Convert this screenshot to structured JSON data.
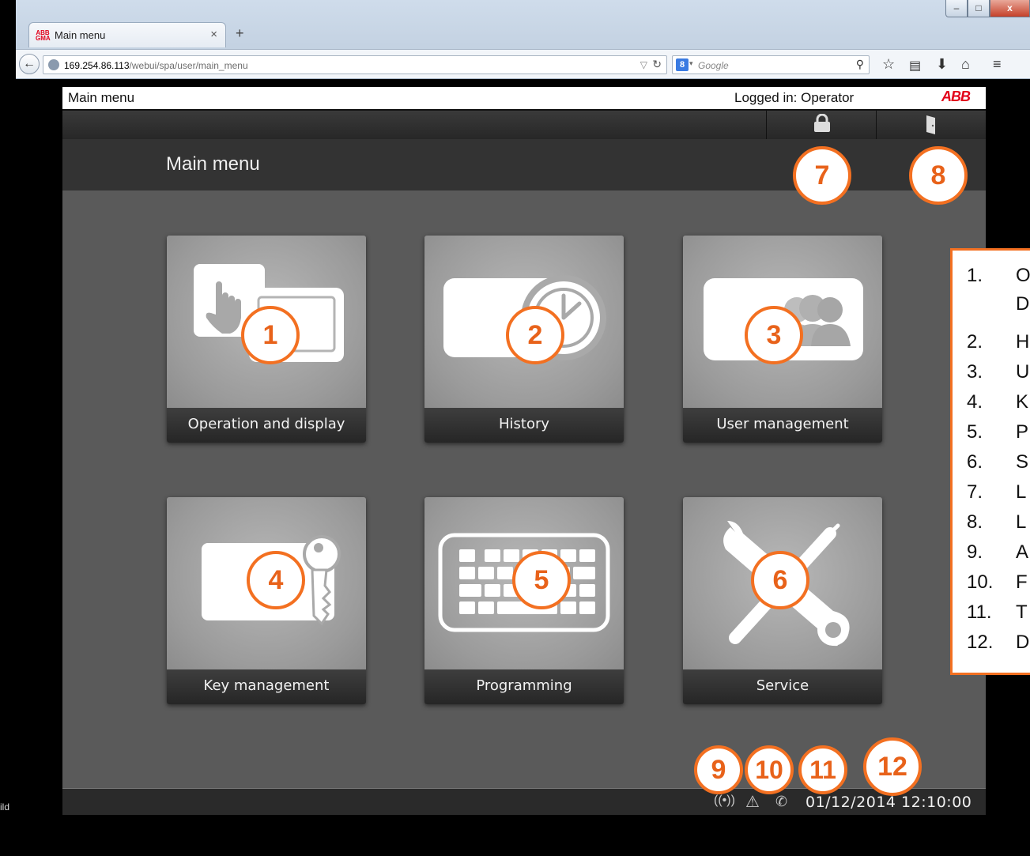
{
  "browser": {
    "tab_title": "Main menu",
    "tab_close": "×",
    "new_tab": "+",
    "url_host": "169.254.86.113",
    "url_path": "/webui/spa/user/main_menu",
    "search_engine": "8",
    "search_placeholder": "Google",
    "window_controls": {
      "minimize": "–",
      "maximize": "□",
      "close": "x"
    },
    "icons": [
      "back-icon",
      "globe-icon",
      "reload-icon",
      "search-icon",
      "star-icon",
      "reading-list-icon",
      "download-icon",
      "home-icon",
      "menu-icon"
    ]
  },
  "app": {
    "title": "Main menu",
    "logged_in": "Logged in: Operator",
    "brand": "ABB",
    "page_title": "Main menu",
    "toolbar": {
      "lock_icon": "lock-icon",
      "logout_icon": "door-icon"
    },
    "tiles": [
      {
        "label": "Operation and display",
        "icon": "touch-screen-icon"
      },
      {
        "label": "History",
        "icon": "clock-icon"
      },
      {
        "label": "User management",
        "icon": "users-icon"
      },
      {
        "label": "Key management",
        "icon": "key-icon"
      },
      {
        "label": "Programming",
        "icon": "keyboard-icon"
      },
      {
        "label": "Service",
        "icon": "tools-icon"
      }
    ],
    "status": {
      "datetime": "01/12/2014 12:10:00",
      "icons": [
        "alarm-icon",
        "warning-icon",
        "phone-icon"
      ]
    }
  },
  "callouts": [
    "1",
    "2",
    "3",
    "4",
    "5",
    "6",
    "7",
    "8",
    "9",
    "10",
    "11",
    "12"
  ],
  "legend": [
    {
      "num": "1.",
      "text": "O"
    },
    {
      "num": "",
      "text": "D"
    },
    {
      "num": "2.",
      "text": "H"
    },
    {
      "num": "3.",
      "text": "U"
    },
    {
      "num": "4.",
      "text": "K"
    },
    {
      "num": "5.",
      "text": "P"
    },
    {
      "num": "6.",
      "text": "S"
    },
    {
      "num": "7.",
      "text": "L"
    },
    {
      "num": "8.",
      "text": "L"
    },
    {
      "num": "9.",
      "text": "A"
    },
    {
      "num": "10.",
      "text": "F"
    },
    {
      "num": "11.",
      "text": "T"
    },
    {
      "num": "12.",
      "text": "D"
    }
  ],
  "side_text": "ild"
}
